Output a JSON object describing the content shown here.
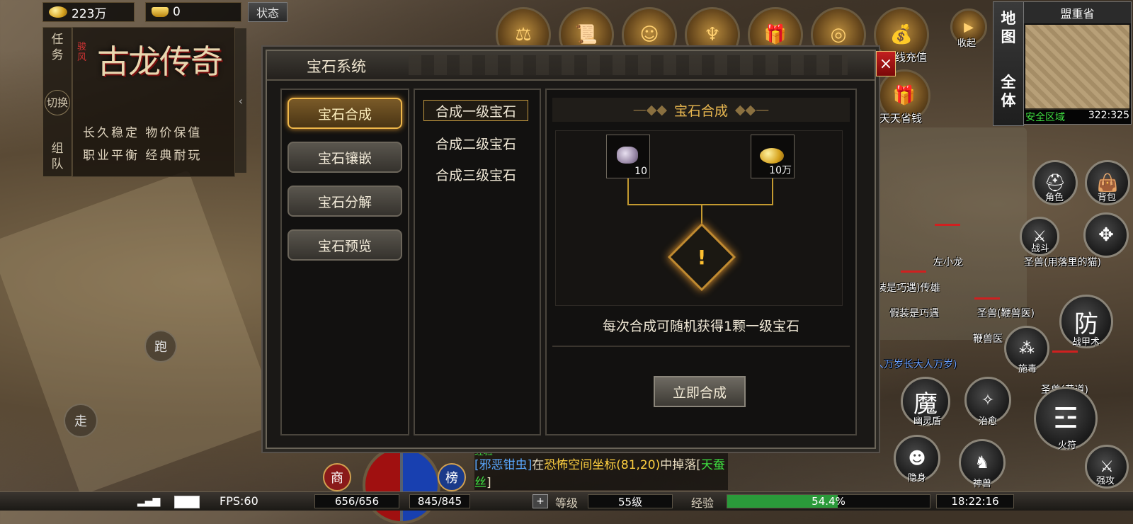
{
  "currency": {
    "gold": "223万",
    "ingot": "0",
    "status_label": "状态"
  },
  "quest_panel": {
    "tabs": [
      {
        "label": "任务"
      },
      {
        "label": "切换"
      },
      {
        "label": "组队"
      }
    ],
    "logo_small": "骏风",
    "logo_title": "古龙传奇",
    "slogan_line1": "长久稳定 物价保值",
    "slogan_line2": "职业平衡 经典耐玩"
  },
  "top_icons": {
    "recharge_label": "线充值",
    "daily_label": "天天省钱",
    "collapse_label": "收起"
  },
  "minimap": {
    "map_label": "地图",
    "all_label": "全体",
    "title": "盟重省",
    "zone": "安全区域",
    "coords": "322:325"
  },
  "dialog": {
    "title": "宝石系统",
    "close": "×",
    "nav": [
      {
        "label": "宝石合成",
        "active": true
      },
      {
        "label": "宝石镶嵌",
        "active": false
      },
      {
        "label": "宝石分解",
        "active": false
      },
      {
        "label": "宝石预览",
        "active": false
      }
    ],
    "sublist": [
      {
        "label": "合成一级宝石",
        "active": true
      },
      {
        "label": "合成二级宝石",
        "active": false
      },
      {
        "label": "合成三级宝石",
        "active": false
      }
    ],
    "section_title": "宝石合成",
    "materials": [
      {
        "icon": "crystal-ore-icon",
        "qty": "10"
      },
      {
        "icon": "gold-coins-icon",
        "qty": "10万"
      }
    ],
    "result_mark": "!",
    "description": "每次合成可随机获得1颗一级宝石",
    "action_label": "立即合成"
  },
  "right_skills": [
    {
      "label": "角色"
    },
    {
      "label": "背包"
    },
    {
      "label": "战斗"
    },
    {
      "label": "战甲术"
    },
    {
      "label": "施毒"
    },
    {
      "label": "幽灵盾"
    },
    {
      "label": "治愈"
    },
    {
      "label": "火符"
    },
    {
      "label": "隐身"
    },
    {
      "label": "神兽"
    },
    {
      "label": "强攻"
    }
  ],
  "right_skill_glyphs": {
    "defense": "防",
    "magic": "魔"
  },
  "name_tags": [
    "左小龙",
    "圣兽(用落里的猫)",
    "装是巧遇)传雄",
    "假装是巧遇",
    "圣兽(鞭兽医)",
    "鞭兽医",
    "人万岁长大人万岁)",
    "圣兽(黄道)"
  ],
  "joystick": {
    "run": "跑",
    "walk": "走"
  },
  "round_buttons": {
    "shop": "商",
    "rank": "榜"
  },
  "chat": {
    "prefix": "经验",
    "monster": "[邪恶钳虫]",
    "text1": "在",
    "place": "恐怖空间",
    "coord_label": "坐标(81,20)",
    "text2": "中掉落[",
    "item": "天蚕丝",
    "suffix": "]"
  },
  "bottom_bar": {
    "fps": "FPS:60",
    "hp": "656/656",
    "mp": "845/845",
    "level_label": "等级",
    "level": "55级",
    "exp_label": "经验",
    "exp_percent": "54.4%",
    "exp_fraction": 0.544,
    "time": "18:22:16"
  }
}
